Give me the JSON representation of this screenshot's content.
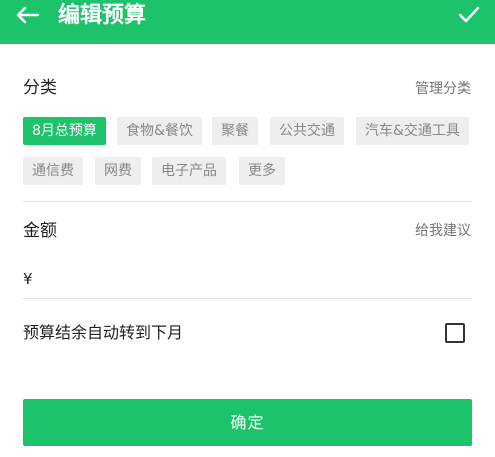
{
  "header": {
    "title": "编辑预算",
    "back_icon": "arrow-left-icon",
    "confirm_icon": "check-icon"
  },
  "category": {
    "label": "分类",
    "manage_link": "管理分类",
    "chips": [
      {
        "label": "8月总预算",
        "selected": true
      },
      {
        "label": "食物&餐饮",
        "selected": false
      },
      {
        "label": "聚餐",
        "selected": false
      },
      {
        "label": "公共交通",
        "selected": false
      },
      {
        "label": "汽车&交通工具",
        "selected": false
      },
      {
        "label": "通信费",
        "selected": false
      },
      {
        "label": "网费",
        "selected": false
      },
      {
        "label": "电子产品",
        "selected": false
      },
      {
        "label": "更多",
        "selected": false
      }
    ]
  },
  "amount": {
    "label": "金额",
    "suggest_link": "给我建议",
    "currency_symbol": "¥",
    "value": ""
  },
  "rollover": {
    "label": "预算结余自动转到下月",
    "checked": false
  },
  "confirm_button": {
    "label": "确定"
  },
  "colors": {
    "accent": "#1dc36b",
    "chip_bg": "#eeeeee",
    "chip_text": "#888888"
  }
}
